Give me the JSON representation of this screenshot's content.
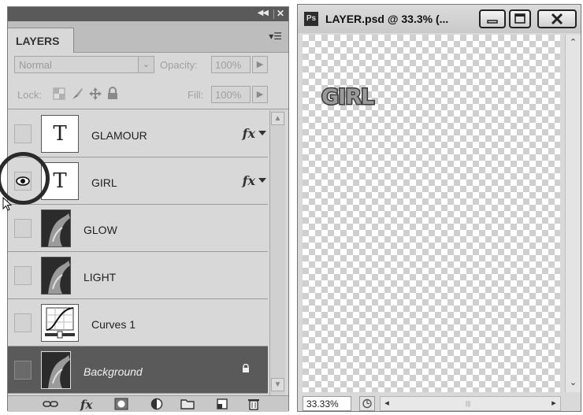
{
  "layers_panel": {
    "tab_label": "LAYERS",
    "collapse_icon": "double-chevron-left-icon",
    "close_icon": "close-icon",
    "menu_icon": "panel-menu-icon",
    "blend_mode": "Normal",
    "opacity_label": "Opacity:",
    "opacity_value": "100%",
    "lock_label": "Lock:",
    "fill_label": "Fill:",
    "fill_value": "100%",
    "layers": [
      {
        "name": "GLAMOUR",
        "kind": "text",
        "thumb_glyph": "T",
        "visible": false,
        "has_fx": true,
        "fx_label": "fx"
      },
      {
        "name": "GIRL",
        "kind": "text",
        "thumb_glyph": "T",
        "visible": true,
        "has_fx": true,
        "fx_label": "fx"
      },
      {
        "name": "GLOW",
        "kind": "image",
        "visible": false
      },
      {
        "name": "LIGHT",
        "kind": "image",
        "visible": false
      },
      {
        "name": "Curves 1",
        "kind": "adjustment",
        "visible": false
      },
      {
        "name": "Background",
        "kind": "image",
        "visible": false,
        "locked": true,
        "selected": true
      }
    ],
    "bottom_icons": [
      "link-layers-icon",
      "fx-icon",
      "add-mask-icon",
      "adjustment-layer-icon",
      "group-folder-icon",
      "new-layer-icon",
      "trash-icon"
    ],
    "bottom_fx_label": "fx"
  },
  "document": {
    "title": "LAYER.psd @ 33.3% (...",
    "app_badge": "Ps",
    "canvas_text": "GIRL",
    "zoom": "33.33%",
    "colors": {
      "canvas_check_light": "#ffffff",
      "canvas_check_dark": "#cfcfcf",
      "selected_layer": "#5a5a5a"
    }
  }
}
